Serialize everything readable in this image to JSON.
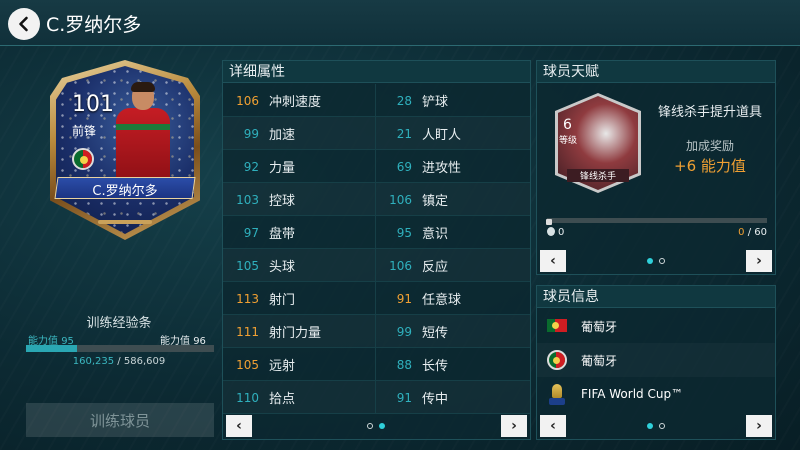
{
  "header": {
    "title": "C.罗纳尔多"
  },
  "card": {
    "rating": "101",
    "position": "前锋",
    "name": "C.罗纳尔多"
  },
  "training": {
    "label": "训练经验条",
    "level_left_label": "能力值",
    "level_left_value": "95",
    "level_right_label": "能力值",
    "level_right_value": "96",
    "exp_current": "160,235",
    "exp_separator": " / ",
    "exp_total": "586,609",
    "exp_fraction": 0.27,
    "button_label": "训练球员"
  },
  "attributes": {
    "title": "详细属性",
    "rows": [
      {
        "left_val": "106",
        "left_name": "冲刺速度",
        "left_hi": true,
        "right_val": "28",
        "right_name": "铲球",
        "right_hi": false
      },
      {
        "left_val": "99",
        "left_name": "加速",
        "left_hi": false,
        "right_val": "21",
        "right_name": "人盯人",
        "right_hi": false
      },
      {
        "left_val": "92",
        "left_name": "力量",
        "left_hi": false,
        "right_val": "69",
        "right_name": "进攻性",
        "right_hi": false
      },
      {
        "left_val": "103",
        "left_name": "控球",
        "left_hi": false,
        "right_val": "106",
        "right_name": "镇定",
        "right_hi": false
      },
      {
        "left_val": "97",
        "left_name": "盘带",
        "left_hi": false,
        "right_val": "95",
        "right_name": "意识",
        "right_hi": false
      },
      {
        "left_val": "105",
        "left_name": "头球",
        "left_hi": false,
        "right_val": "106",
        "right_name": "反应",
        "right_hi": false
      },
      {
        "left_val": "113",
        "left_name": "射门",
        "left_hi": true,
        "right_val": "91",
        "right_name": "任意球",
        "right_hi": true
      },
      {
        "left_val": "111",
        "left_name": "射门力量",
        "left_hi": true,
        "right_val": "99",
        "right_name": "短传",
        "right_hi": false
      },
      {
        "left_val": "105",
        "left_name": "远射",
        "left_hi": true,
        "right_val": "88",
        "right_name": "长传",
        "right_hi": false
      },
      {
        "left_val": "110",
        "left_name": "拾点",
        "left_hi": false,
        "right_val": "91",
        "right_name": "传中",
        "right_hi": false
      }
    ],
    "pager": {
      "prev": "‹",
      "next": "›",
      "active_page": 2,
      "pages": 2
    }
  },
  "talent": {
    "title": "球员天赋",
    "badge_level": "6",
    "badge_level_label": "等级",
    "badge_name": "锋线杀手",
    "item_title": "锋线杀手提升道具",
    "bonus_label": "加成奖励",
    "bonus_value": "+6 能力值",
    "count_left": "0",
    "count_current": "0",
    "count_separator": " / ",
    "count_total": "60",
    "progress_fraction": 0.0,
    "pager": {
      "prev": "‹",
      "next": "›",
      "active_page": 1,
      "pages": 2
    }
  },
  "info": {
    "title": "球员信息",
    "rows": [
      {
        "icon": "portugal-flag-icon",
        "text": "葡萄牙"
      },
      {
        "icon": "portugal-badge-icon",
        "text": "葡萄牙"
      },
      {
        "icon": "world-cup-icon",
        "text": "FIFA World Cup™"
      }
    ],
    "pager": {
      "prev": "‹",
      "next": "›",
      "active_page": 1,
      "pages": 2
    }
  },
  "colors": {
    "accent_teal": "#2fb0bd",
    "highlight_orange": "#f0a033",
    "background": "#0b2a33"
  }
}
